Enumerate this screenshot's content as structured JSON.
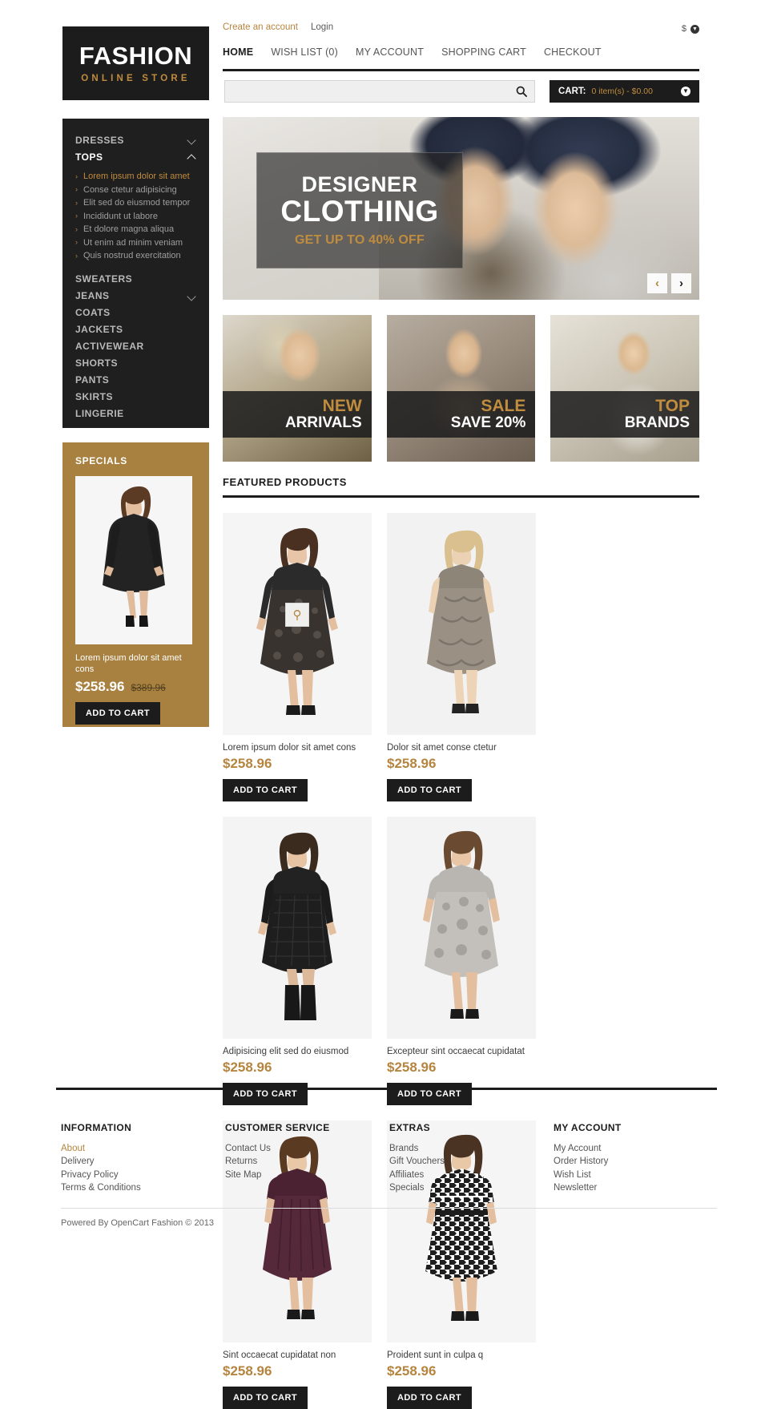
{
  "topbar": {
    "create_account": "Create an account",
    "login": "Login",
    "currency_symbol": "$"
  },
  "logo": {
    "main": "FASHION",
    "sub": "ONLINE STORE"
  },
  "nav": {
    "items": [
      {
        "label": "HOME",
        "active": true
      },
      {
        "label": "WISH LIST (0)",
        "active": false
      },
      {
        "label": "MY ACCOUNT",
        "active": false
      },
      {
        "label": "SHOPPING CART",
        "active": false
      },
      {
        "label": "CHECKOUT",
        "active": false
      }
    ]
  },
  "search": {
    "value": "",
    "placeholder": ""
  },
  "cart": {
    "label": "CART:",
    "summary": "0 item(s) - $0.00"
  },
  "sidebar": {
    "categories": [
      {
        "label": "DRESSES",
        "state": "collapsed"
      },
      {
        "label": "TOPS",
        "state": "expanded"
      },
      {
        "label": "SWEATERS",
        "state": "none"
      },
      {
        "label": "JEANS",
        "state": "collapsed"
      },
      {
        "label": "COATS",
        "state": "none"
      },
      {
        "label": "JACKETS",
        "state": "none"
      },
      {
        "label": "ACTIVEWEAR",
        "state": "none"
      },
      {
        "label": "SHORTS",
        "state": "none"
      },
      {
        "label": "PANTS",
        "state": "none"
      },
      {
        "label": "SKIRTS",
        "state": "none"
      },
      {
        "label": "LINGERIE",
        "state": "none"
      }
    ],
    "tops_subitems": [
      {
        "label": "Lorem ipsum dolor sit amet",
        "active": true
      },
      {
        "label": "Conse ctetur adipisicing",
        "active": false
      },
      {
        "label": "Elit sed do eiusmod tempor",
        "active": false
      },
      {
        "label": "Incididunt ut labore",
        "active": false
      },
      {
        "label": "Et dolore magna aliqua",
        "active": false
      },
      {
        "label": "Ut enim ad minim veniam",
        "active": false
      },
      {
        "label": "Quis nostrud exercitation",
        "active": false
      }
    ]
  },
  "specials": {
    "title": "SPECIALS",
    "product_name": "Lorem ipsum dolor sit amet cons",
    "price_new": "$258.96",
    "price_old": "$389.96",
    "add_to_cart": "ADD TO CART"
  },
  "hero": {
    "line1": "DESIGNER",
    "line2": "CLOTHING",
    "line3": "GET UP TO 40% OFF",
    "prev_arrow": "‹",
    "next_arrow": "›"
  },
  "promos": [
    {
      "top": "NEW",
      "bottom": "ARRIVALS"
    },
    {
      "top": "SALE",
      "bottom": "SAVE 20%"
    },
    {
      "top": "TOP",
      "bottom": "BRANDS"
    }
  ],
  "featured": {
    "heading": "FEATURED PRODUCTS",
    "add_to_cart": "ADD TO CART",
    "products": [
      {
        "name": "Lorem ipsum dolor sit amet cons",
        "price": "$258.96"
      },
      {
        "name": "Dolor sit amet conse ctetur",
        "price": "$258.96"
      },
      {
        "name": "Adipisicing elit sed do eiusmod",
        "price": "$258.96"
      },
      {
        "name": "Excepteur sint occaecat cupidatat",
        "price": "$258.96"
      },
      {
        "name": "Sint occaecat cupidatat non",
        "price": "$258.96"
      },
      {
        "name": "Proident sunt in culpa q",
        "price": "$258.96"
      }
    ]
  },
  "footer": {
    "columns": [
      {
        "title": "INFORMATION",
        "links": [
          {
            "label": "About",
            "active": true
          },
          {
            "label": "Delivery",
            "active": false
          },
          {
            "label": "Privacy Policy",
            "active": false
          },
          {
            "label": "Terms & Conditions",
            "active": false
          }
        ]
      },
      {
        "title": "CUSTOMER SERVICE",
        "links": [
          {
            "label": "Contact Us",
            "active": false
          },
          {
            "label": "Returns",
            "active": false
          },
          {
            "label": "Site Map",
            "active": false
          }
        ]
      },
      {
        "title": "EXTRAS",
        "links": [
          {
            "label": "Brands",
            "active": false
          },
          {
            "label": "Gift Vouchers",
            "active": false
          },
          {
            "label": "Affiliates",
            "active": false
          },
          {
            "label": "Specials",
            "active": false
          }
        ]
      },
      {
        "title": "MY ACCOUNT",
        "links": [
          {
            "label": "My Account",
            "active": false
          },
          {
            "label": "Order History",
            "active": false
          },
          {
            "label": "Wish List",
            "active": false
          },
          {
            "label": "Newsletter",
            "active": false
          }
        ]
      }
    ],
    "copyright": "Powered By OpenCart Fashion © 2013"
  },
  "colors": {
    "accent": "#b5853f",
    "dark": "#1c1c1c",
    "specials_bg": "#a8803f"
  }
}
